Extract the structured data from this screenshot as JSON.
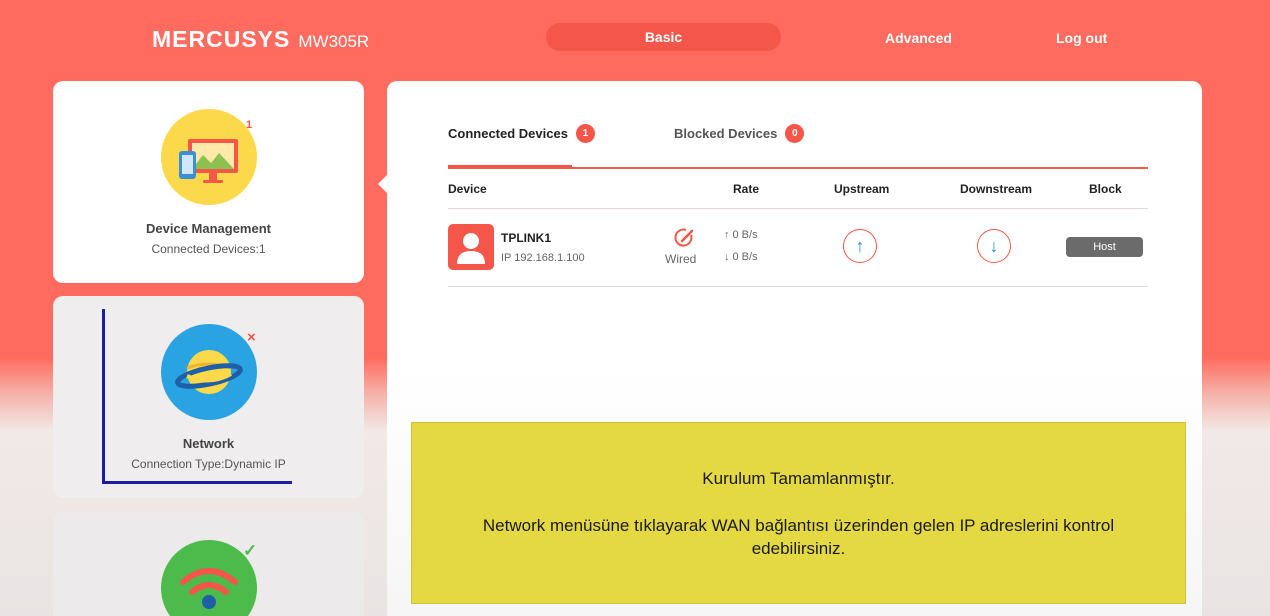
{
  "header": {
    "brand": "MERCUSYS",
    "model": "MW305R",
    "nav": {
      "basic": "Basic",
      "advanced": "Advanced",
      "logout": "Log out"
    }
  },
  "sidebar": {
    "device_management": {
      "title": "Device Management",
      "subtitle": "Connected Devices:1",
      "badge": "1"
    },
    "network": {
      "title": "Network",
      "subtitle": "Connection Type:Dynamic IP",
      "badge": "×"
    },
    "wireless": {
      "badge": "✓"
    }
  },
  "tabs": {
    "connected": {
      "label": "Connected Devices",
      "count": "1"
    },
    "blocked": {
      "label": "Blocked Devices",
      "count": "0"
    }
  },
  "table": {
    "columns": {
      "device": "Device",
      "rate": "Rate",
      "upstream": "Upstream",
      "downstream": "Downstream",
      "block": "Block"
    },
    "rows": [
      {
        "name": "TPLINK1",
        "ip": "IP 192.168.1.100",
        "connection": "Wired",
        "rate_up": "0 B/s",
        "rate_down": "0 B/s",
        "block_label": "Host"
      }
    ]
  },
  "notice": {
    "line1": "Kurulum Tamamlanmıştır.",
    "line2": "Network menüsüne tıklayarak WAN bağlantısı üzerinden gelen IP adreslerini kontrol edebilirsiniz."
  },
  "colors": {
    "accent": "#f4564a",
    "notice_bg": "#e4d943",
    "arrow_blue": "#2d86d1"
  }
}
